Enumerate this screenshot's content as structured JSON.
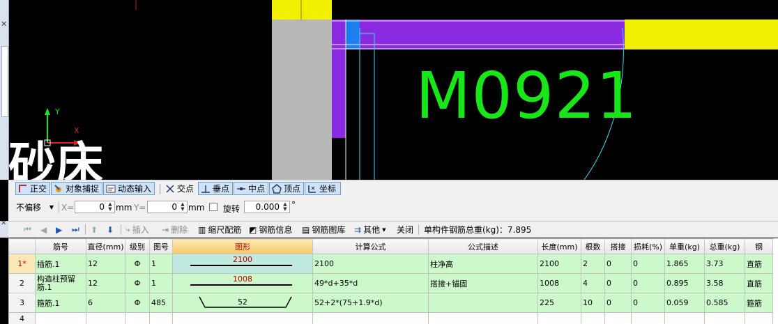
{
  "canvas": {
    "door_label": "M0921",
    "partial_text": "砂床",
    "axis_y": "Y",
    "axis_x": "X",
    "colors": {
      "yellow": "#f0f000",
      "purple": "#8a2be2",
      "blue": "#1e7ff0",
      "green_text": "#18e618",
      "cyan": "#3ee0f0",
      "gray": "#b8b8b8"
    }
  },
  "snap_toolbar": {
    "ortho": "正交",
    "object_snap": "对象捕捉",
    "dynamic_input": "动态输入",
    "intersection": "交点",
    "perpendicular": "垂点",
    "midpoint": "中点",
    "vertex": "顶点",
    "coordinate": "坐标"
  },
  "coord_bar": {
    "offset_mode": "不偏移",
    "x_label": "X=",
    "x_value": "0",
    "x_unit": "mm",
    "y_label": "Y=",
    "y_value": "0",
    "y_unit": "mm",
    "rotate_label": "旋转",
    "rotate_value": "0.000",
    "degree": "°"
  },
  "rebar_toolbar": {
    "insert": "插入",
    "delete": "删除",
    "scale_rebar": "缩尺配筋",
    "rebar_info": "钢筋信息",
    "rebar_library": "钢筋图库",
    "other": "其他",
    "close": "关闭",
    "total_weight": "单构件钢筋总重(kg)：7.895"
  },
  "table": {
    "headers": [
      "筋号",
      "直径(mm)",
      "级别",
      "图号",
      "图形",
      "计算公式",
      "公式描述",
      "长度(mm)",
      "根数",
      "搭接",
      "损耗(%)",
      "单重(kg)",
      "总重(kg)",
      "钢"
    ],
    "rows": [
      {
        "no": "1*",
        "name": "插筋.1",
        "dia": "12",
        "grade": "Φ",
        "fig": "1",
        "shape": "2100",
        "formula": "2100",
        "desc": "柱净高",
        "length": "2100",
        "count": "2",
        "lap": "0",
        "loss": "0",
        "unit_w": "1.865",
        "total_w": "3.73",
        "type": "直筋"
      },
      {
        "no": "2",
        "name": "构造柱预留筋.1",
        "dia": "12",
        "grade": "Φ",
        "fig": "1",
        "shape": "1008",
        "formula": "49*d+35*d",
        "desc": "搭接+锚固",
        "length": "1008",
        "count": "4",
        "lap": "0",
        "loss": "0",
        "unit_w": "0.895",
        "total_w": "3.58",
        "type": "直筋"
      },
      {
        "no": "3",
        "name": "箍筋.1",
        "dia": "6",
        "grade": "Φ",
        "fig": "485",
        "shape": "52",
        "formula": "52+2*(75+1.9*d)",
        "desc": "",
        "length": "225",
        "count": "10",
        "lap": "0",
        "loss": "0",
        "unit_w": "0.059",
        "total_w": "0.585",
        "type": "箍筋"
      }
    ],
    "empty_row_no": "4"
  }
}
